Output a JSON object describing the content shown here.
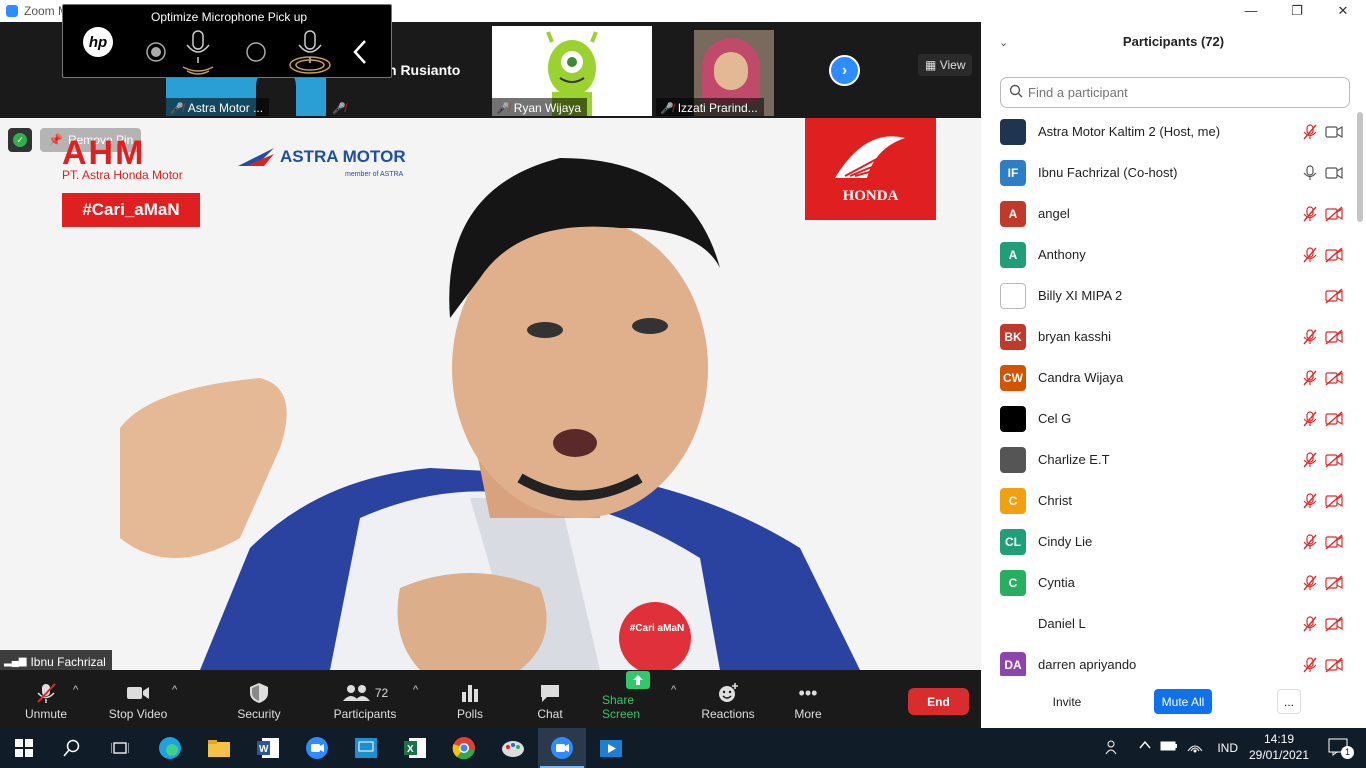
{
  "window": {
    "title": "Zoom M",
    "controls": [
      "—",
      "❐",
      "✕"
    ]
  },
  "hp_popup": {
    "logo": "hp",
    "title": "Optimize Microphone Pick up"
  },
  "thumbnails": [
    {
      "label": "Astra Motor ...",
      "muted": true
    },
    {
      "label": "n Rusianto",
      "muted": true
    },
    {
      "label": "Ryan Wijaya",
      "muted": true
    },
    {
      "label": "Izzati Prarind...",
      "muted": true
    }
  ],
  "view_button": "View",
  "speaker": {
    "name": "Ibnu Fachrizal",
    "remove_pin": "Remove Pin",
    "logos": {
      "ahm": "AHM",
      "ahm_sub": "PT. Astra Honda Motor",
      "astra_motor": "ASTRA MOTOR",
      "astra_sub": "member of ASTRA",
      "cari_aman": "#Cari_aMaN",
      "honda": "HONDA"
    },
    "badge": "#Cari aMaN"
  },
  "toolbar": {
    "unmute": "Unmute",
    "stop_video": "Stop Video",
    "security": "Security",
    "participants": "Participants",
    "participants_count": "72",
    "polls": "Polls",
    "chat": "Chat",
    "share_screen": "Share Screen",
    "reactions": "Reactions",
    "more": "More",
    "end": "End"
  },
  "panel": {
    "title": "Participants (72)",
    "search_placeholder": "Find a participant",
    "invite": "Invite",
    "mute_all": "Mute All",
    "more": "..."
  },
  "participants": [
    {
      "name": "Astra Motor Kaltim 2 (Host, me)",
      "initials": "",
      "color": "#1d3550",
      "mic": "muted",
      "cam": "on"
    },
    {
      "name": "Ibnu Fachrizal (Co-host)",
      "initials": "IF",
      "color": "#2e7ec6",
      "mic": "on",
      "cam": "on"
    },
    {
      "name": "angel",
      "initials": "A",
      "color": "#c0392b",
      "mic": "muted",
      "cam": "off"
    },
    {
      "name": "Anthony",
      "initials": "A",
      "color": "#1f9e77",
      "mic": "muted",
      "cam": "off"
    },
    {
      "name": "Billy XI MIPA 2",
      "initials": "",
      "color": "#ffffff",
      "mic": "none",
      "cam": "off"
    },
    {
      "name": "bryan kasshi",
      "initials": "BK",
      "color": "#c0392b",
      "mic": "muted",
      "cam": "off"
    },
    {
      "name": "Candra Wijaya",
      "initials": "CW",
      "color": "#d35400",
      "mic": "muted",
      "cam": "off"
    },
    {
      "name": "Cel G",
      "initials": "",
      "color": "#000000",
      "mic": "muted",
      "cam": "off"
    },
    {
      "name": "Charlize E.T",
      "initials": "",
      "color": "#555555",
      "mic": "muted",
      "cam": "off"
    },
    {
      "name": "Christ",
      "initials": "C",
      "color": "#f0a010",
      "mic": "muted",
      "cam": "off"
    },
    {
      "name": "Cindy Lie",
      "initials": "CL",
      "color": "#1f9e77",
      "mic": "muted",
      "cam": "off"
    },
    {
      "name": "Cyntia",
      "initials": "C",
      "color": "#27ae60",
      "mic": "muted",
      "cam": "off"
    },
    {
      "name": "Daniel L",
      "initials": "",
      "color": "#ffffff",
      "mic": "muted",
      "cam": "off"
    },
    {
      "name": "darren apriyando",
      "initials": "DA",
      "color": "#8e44ad",
      "mic": "muted",
      "cam": "off"
    }
  ],
  "taskbar": {
    "language": "IND",
    "time": "14:19",
    "date": "29/01/2021",
    "notifications": "1"
  }
}
